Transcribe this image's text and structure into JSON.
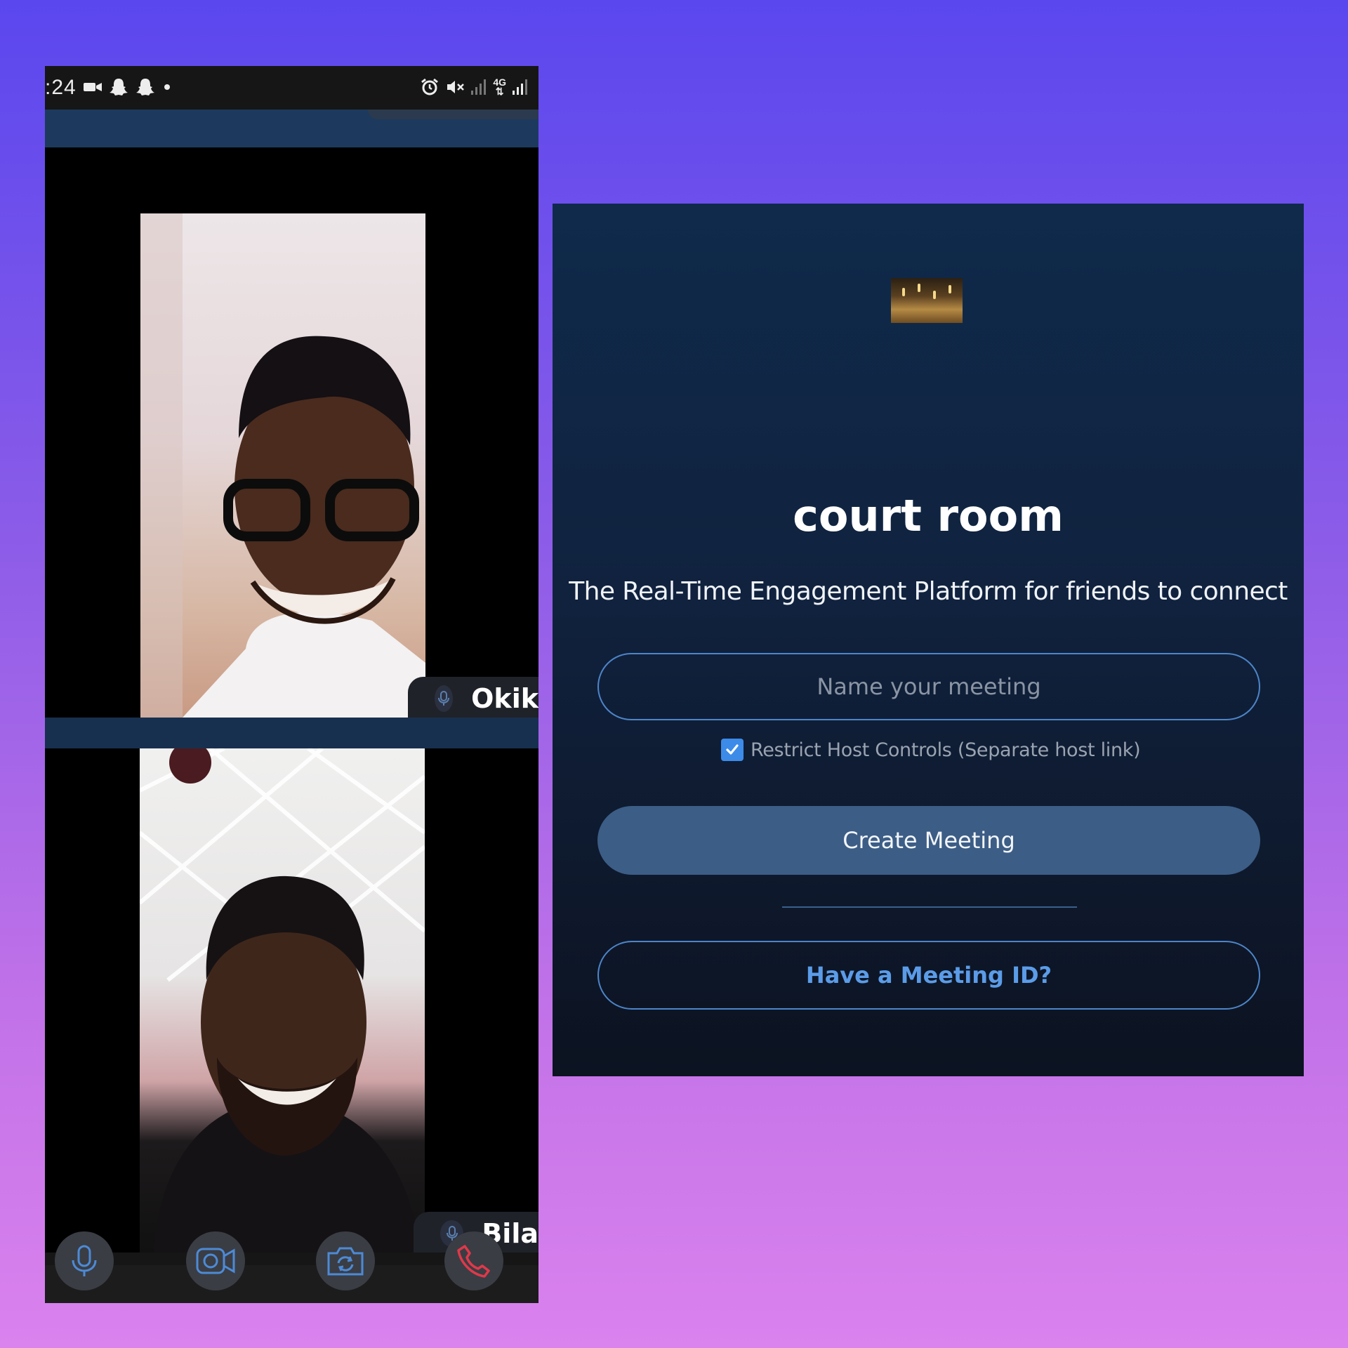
{
  "phone": {
    "status_bar": {
      "time": ":24",
      "network_type": "4G",
      "left_icons": [
        "video-recording-icon",
        "snapchat-icon",
        "snapchat-icon",
        "notification-dot-icon"
      ],
      "right_icons": [
        "alarm-icon",
        "mute-icon",
        "signal-icon",
        "4g-data-icon",
        "signal-icon"
      ]
    },
    "participants": [
      {
        "name": "Okik"
      },
      {
        "name": "Bila"
      }
    ],
    "controls": {
      "icons": [
        "microphone-icon",
        "video-camera-icon",
        "switch-camera-icon",
        "end-call-icon"
      ],
      "end_call_color": "#e0384a",
      "icon_color": "#4d8ad6"
    }
  },
  "court_room": {
    "title": "court room",
    "tagline": "The Real-Time Engagement Platform for friends to connect",
    "meeting_name_input": {
      "placeholder": "Name your meeting",
      "value": ""
    },
    "restrict_host_controls": {
      "label": "Restrict Host Controls (Separate host link)",
      "checked": true
    },
    "create_button_label": "Create Meeting",
    "join_button_label": "Have a Meeting ID?",
    "colors": {
      "accent": "#4d85c9",
      "primary_button": "#3c5d85",
      "checkbox": "#3d8be8",
      "link_text": "#5b9ce8"
    }
  }
}
